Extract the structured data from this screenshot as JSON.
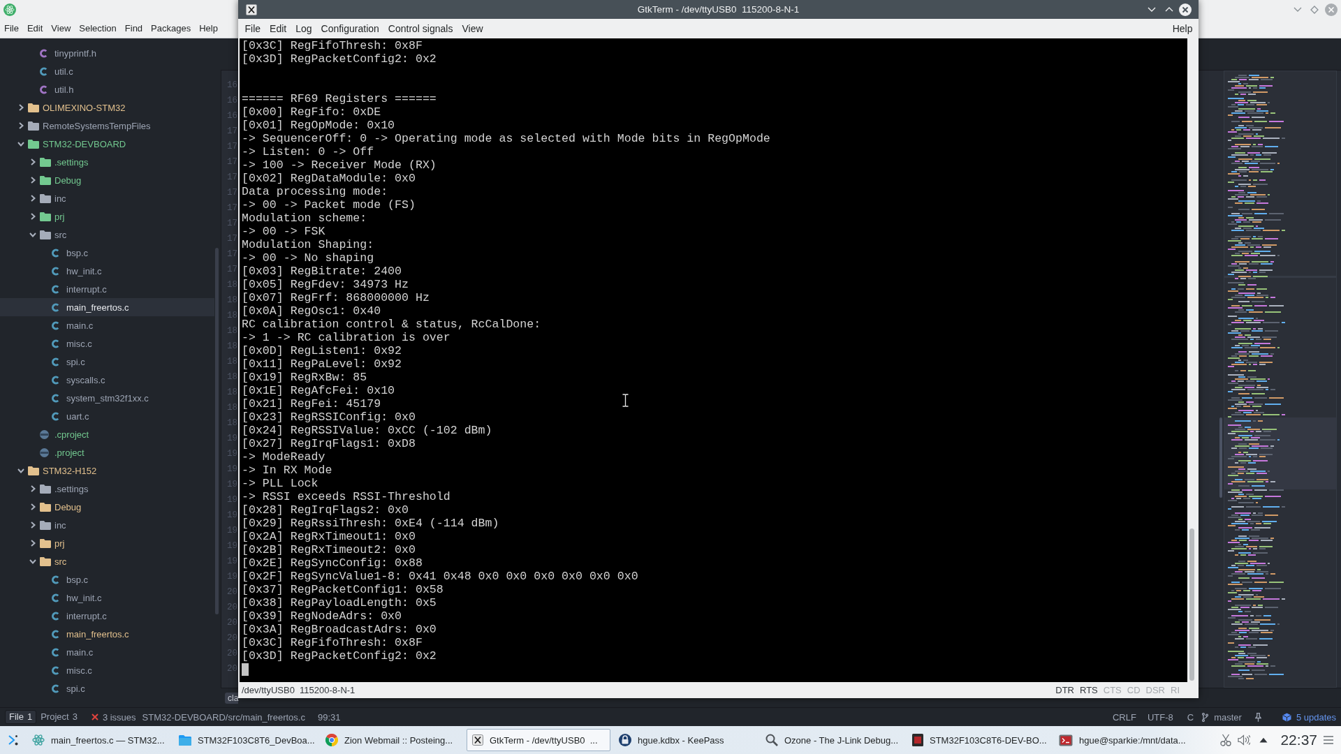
{
  "editor_window": {
    "menu": [
      "File",
      "Edit",
      "View",
      "Selection",
      "Find",
      "Packages",
      "Help"
    ],
    "tree": {
      "continued_items": [
        {
          "name": "tinyprintf.h",
          "kind": "header",
          "added": false,
          "modified": false,
          "selected": false
        },
        {
          "name": "util.c",
          "kind": "source",
          "added": false,
          "modified": false,
          "selected": false
        },
        {
          "name": "util.h",
          "kind": "header",
          "added": false,
          "modified": false,
          "selected": false
        }
      ],
      "items": [
        {
          "name": "OLIMEXINO-STM32",
          "kind": "folder",
          "added": false,
          "modified": true,
          "selected": false,
          "expanded": false
        },
        {
          "name": "RemoteSystemsTempFiles",
          "kind": "folder",
          "added": false,
          "modified": false,
          "selected": false,
          "expanded": false
        },
        {
          "name": "STM32-DEVBOARD",
          "kind": "folder",
          "added": true,
          "modified": false,
          "selected": false,
          "expanded": true,
          "children": [
            {
              "name": ".settings",
              "kind": "folder",
              "added": true,
              "modified": false,
              "selected": false,
              "expanded": false
            },
            {
              "name": "Debug",
              "kind": "folder",
              "added": true,
              "modified": false,
              "selected": false,
              "expanded": false
            },
            {
              "name": "inc",
              "kind": "folder",
              "added": false,
              "modified": false,
              "selected": false,
              "expanded": false
            },
            {
              "name": "prj",
              "kind": "folder",
              "added": true,
              "modified": false,
              "selected": false,
              "expanded": false
            },
            {
              "name": "src",
              "kind": "folder",
              "added": false,
              "modified": false,
              "selected": false,
              "expanded": true,
              "children": [
                {
                  "name": "bsp.c",
                  "kind": "source",
                  "added": false,
                  "modified": false,
                  "selected": false
                },
                {
                  "name": "hw_init.c",
                  "kind": "source",
                  "added": false,
                  "modified": false,
                  "selected": false
                },
                {
                  "name": "interrupt.c",
                  "kind": "source",
                  "added": false,
                  "modified": false,
                  "selected": false
                },
                {
                  "name": "main_freertos.c",
                  "kind": "source",
                  "added": false,
                  "modified": false,
                  "selected": true
                },
                {
                  "name": "main.c",
                  "kind": "source",
                  "added": false,
                  "modified": false,
                  "selected": false
                },
                {
                  "name": "misc.c",
                  "kind": "source",
                  "added": false,
                  "modified": false,
                  "selected": false
                },
                {
                  "name": "spi.c",
                  "kind": "source",
                  "added": false,
                  "modified": false,
                  "selected": false
                },
                {
                  "name": "syscalls.c",
                  "kind": "source",
                  "added": false,
                  "modified": false,
                  "selected": false
                },
                {
                  "name": "system_stm32f1xx.c",
                  "kind": "source",
                  "added": false,
                  "modified": false,
                  "selected": false
                },
                {
                  "name": "uart.c",
                  "kind": "source",
                  "added": false,
                  "modified": false,
                  "selected": false
                }
              ]
            },
            {
              "name": ".cproject",
              "kind": "project",
              "added": true,
              "modified": false,
              "selected": false
            },
            {
              "name": ".project",
              "kind": "project",
              "added": true,
              "modified": false,
              "selected": false
            }
          ]
        },
        {
          "name": "STM32-H152",
          "kind": "folder",
          "added": false,
          "modified": true,
          "selected": false,
          "expanded": true,
          "children": [
            {
              "name": ".settings",
              "kind": "folder",
              "added": false,
              "modified": false,
              "selected": false,
              "expanded": false
            },
            {
              "name": "Debug",
              "kind": "folder",
              "added": false,
              "modified": true,
              "selected": false,
              "expanded": false
            },
            {
              "name": "inc",
              "kind": "folder",
              "added": false,
              "modified": false,
              "selected": false,
              "expanded": false
            },
            {
              "name": "prj",
              "kind": "folder",
              "added": false,
              "modified": true,
              "selected": false,
              "expanded": false
            },
            {
              "name": "src",
              "kind": "folder",
              "added": false,
              "modified": true,
              "selected": false,
              "expanded": true,
              "children": [
                {
                  "name": "bsp.c",
                  "kind": "source",
                  "added": false,
                  "modified": false,
                  "selected": false
                },
                {
                  "name": "hw_init.c",
                  "kind": "source",
                  "added": false,
                  "modified": false,
                  "selected": false
                },
                {
                  "name": "interrupt.c",
                  "kind": "source",
                  "added": false,
                  "modified": false,
                  "selected": false
                },
                {
                  "name": "main_freertos.c",
                  "kind": "source",
                  "added": false,
                  "modified": true,
                  "selected": false
                },
                {
                  "name": "main.c",
                  "kind": "source",
                  "added": false,
                  "modified": false,
                  "selected": false
                },
                {
                  "name": "misc.c",
                  "kind": "source",
                  "added": false,
                  "modified": false,
                  "selected": false
                },
                {
                  "name": "spi.c",
                  "kind": "source",
                  "added": false,
                  "modified": false,
                  "selected": false
                }
              ]
            }
          ]
        }
      ]
    },
    "gutter_numbers": [
      "16",
      "16",
      "16",
      "17",
      "17",
      "17",
      "17",
      "17",
      "17",
      "17",
      "17",
      "17",
      "17",
      "18",
      "18",
      "18",
      "18",
      "18",
      "18",
      "18",
      "18",
      "18",
      "18",
      "19",
      "19",
      "19",
      "19",
      "19",
      "19",
      "19",
      "19",
      "19",
      "19",
      "20",
      "20",
      "20",
      "20",
      "20",
      "20"
    ],
    "dock_tag": "cla",
    "status_bar": {
      "tabs": [
        {
          "label": "File",
          "count": "1",
          "selected": true
        },
        {
          "label": "Project",
          "count": "3",
          "selected": false
        }
      ],
      "issues": "3 issues",
      "file_path": "STM32-DEVBOARD/src/main_freertos.c",
      "cursor_position": "99:31",
      "line_ending": "CRLF",
      "encoding": "UTF-8",
      "grammar": "C",
      "branch": "master",
      "updates": "5 updates"
    }
  },
  "terminal_window": {
    "title": "GtkTerm - /dev/ttyUSB0  115200-8-N-1",
    "menu": [
      "File",
      "Edit",
      "Log",
      "Configuration",
      "Control signals",
      "View"
    ],
    "help_menu": "Help",
    "output_blocks": [
      {
        "lines": [
          "[0x3C] RegFifoThresh: 0x8F",
          "[0x3D] RegPacketConfig2: 0x2"
        ]
      },
      {
        "lines": [
          "====== RF69 Registers ======",
          "[0x00] RegFifo: 0xDE",
          "[0x01] RegOpMode: 0x10",
          "-> SequencerOff: 0 -> Operating mode as selected with Mode bits in RegOpMode",
          "-> Listen: 0 -> Off",
          "-> 100 -> Receiver Mode (RX)",
          "[0x02] RegDataModule: 0x0",
          "Data processing mode:",
          "-> 00 -> Packet mode (FS)",
          "Modulation scheme:",
          "-> 00 -> FSK",
          "Modulation Shaping:",
          "-> 00 -> No shaping",
          "[0x03] RegBitrate: 2400",
          "[0x05] RegFdev: 34973 Hz",
          "[0x07] RegFrf: 868000000 Hz",
          "[0x0A] RegOsc1: 0x40",
          "RC calibration control & status, RcCalDone:",
          "-> 1 -> RC calibration is over",
          "[0x0D] RegListen1: 0x92",
          "[0x11] RegPaLevel: 0x92",
          "[0x19] RegRxBw: 85",
          "[0x1E] RegAfcFei: 0x10",
          "[0x21] RegFei: 45179",
          "[0x23] RegRSSIConfig: 0x0",
          "[0x24] RegRSSIValue: 0xCC (-102 dBm)",
          "[0x27] RegIrqFlags1: 0xD8",
          "-> ModeReady",
          "-> In RX Mode",
          "-> PLL Lock",
          "-> RSSI exceeds RSSI-Threshold",
          "[0x28] RegIrqFlags2: 0x0",
          "[0x29] RegRssiThresh: 0xE4 (-114 dBm)",
          "[0x2A] RegRxTimeout1: 0x0",
          "[0x2B] RegRxTimeout2: 0x0",
          "[0x2E] RegSyncConfig: 0x88",
          "[0x2F] RegSyncValue1-8: 0x41 0x48 0x0 0x0 0x0 0x0 0x0 0x0",
          "[0x37] RegPacketConfig1: 0x58",
          "[0x38] RegPayloadLength: 0x5",
          "[0x39] RegNodeAdrs: 0x0",
          "[0x3A] RegBroadcastAdrs: 0x0",
          "[0x3C] RegFifoThresh: 0x8F",
          "[0x3D] RegPacketConfig2: 0x2"
        ]
      }
    ],
    "status": "/dev/ttyUSB0  115200-8-N-1",
    "signals": [
      {
        "label": "DTR",
        "on": true
      },
      {
        "label": "RTS",
        "on": true
      },
      {
        "label": "CTS",
        "on": false
      },
      {
        "label": "CD",
        "on": false
      },
      {
        "label": "DSR",
        "on": false
      },
      {
        "label": "RI",
        "on": false
      }
    ]
  },
  "taskbar": {
    "tasks": [
      {
        "kind": "editor",
        "label": "main_freertos.c — STM32...",
        "selected": false
      },
      {
        "kind": "files",
        "label": "STM32F103C8T6_DevBoa...",
        "selected": false
      },
      {
        "kind": "browser",
        "label": "Zion Webmail :: Posteing...",
        "selected": false
      },
      {
        "kind": "serial",
        "label": "GtkTerm - /dev/ttyUSB0  ...",
        "selected": true
      },
      {
        "kind": "passwords",
        "label": "hgue.kdbx - KeePass",
        "selected": false
      },
      {
        "kind": "debugger",
        "label": "Ozone - The J-Link Debug...",
        "selected": false
      },
      {
        "kind": "viewer",
        "label": "STM32F103C8T6-DEV-BO...",
        "selected": false
      },
      {
        "kind": "console",
        "label": "hgue@sparkie:/mnt/data...",
        "selected": false
      }
    ],
    "clock": "22:37"
  }
}
